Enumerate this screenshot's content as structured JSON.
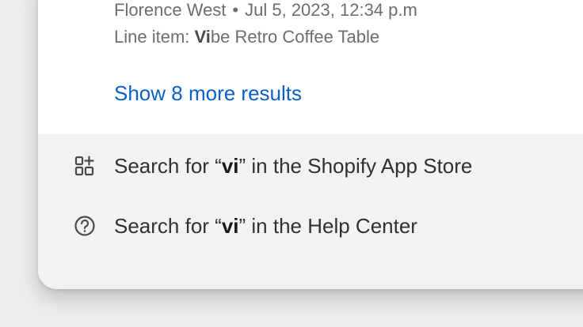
{
  "result": {
    "author": "Florence West",
    "separator": "•",
    "date": "Jul 5, 2023, 12:34 p.m",
    "line_item_prefix": "Line item: ",
    "line_item_match": "Vi",
    "line_item_rest": "be Retro Coffee Table"
  },
  "show_more": {
    "label": "Show 8 more results",
    "color": "#0b5fcc"
  },
  "footer": {
    "items": [
      {
        "icon": "app-store-icon",
        "prefix": "Search for “",
        "query": "vi",
        "suffix": "” in the Shopify App Store"
      },
      {
        "icon": "help-circle-icon",
        "prefix": "Search for “",
        "query": "vi",
        "suffix": "” in the Help Center"
      }
    ]
  }
}
